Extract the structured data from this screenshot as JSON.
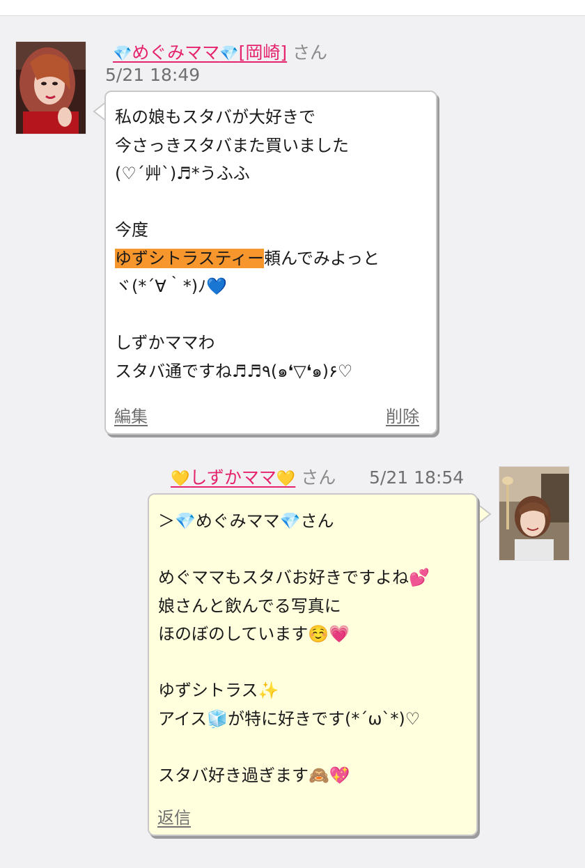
{
  "post1": {
    "author_prefix_icon": "💎",
    "author_name": "めぐみママ",
    "author_suffix_icon": "💎",
    "author_location": "[岡崎]",
    "honorific": "さん",
    "timestamp": "5/21 18:49",
    "lines": [
      "私の娘もスタバが大好きで",
      "今さっきスタバまた買いました",
      "(♡´艸`)♬*うふふ",
      "",
      "今度",
      "頼んでみよっと",
      "ヾ(*´∀｀*)ﾉ💙",
      "",
      "しずかママわ",
      "スタバ通ですね♬♬٩(๑❛▽❛๑)۶♡"
    ],
    "highlight_text": "ゆずシトラスティー",
    "edit_label": "編集",
    "delete_label": "削除"
  },
  "post2": {
    "author_prefix_icon": "💛",
    "author_name": "しずかママ",
    "author_suffix_icon": "💛",
    "honorific": "さん",
    "timestamp": "5/21 18:54",
    "lines": [
      "＞💎めぐみママ💎さん",
      "",
      "めぐママもスタバお好きですよね💕",
      "娘さんと飲んでる写真に",
      "ほのぼのしています☺️💗",
      "",
      "ゆずシトラス✨",
      "アイス🧊が特に好きです(*´ω`*)♡",
      "",
      "スタバ好き過ぎます🙈💖"
    ],
    "reply_label": "返信"
  },
  "colors": {
    "name_link": "#e5236d",
    "highlight": "#f7962c",
    "reply_bubble_bg": "#ffffde",
    "muted_text": "#6f6f6f"
  }
}
